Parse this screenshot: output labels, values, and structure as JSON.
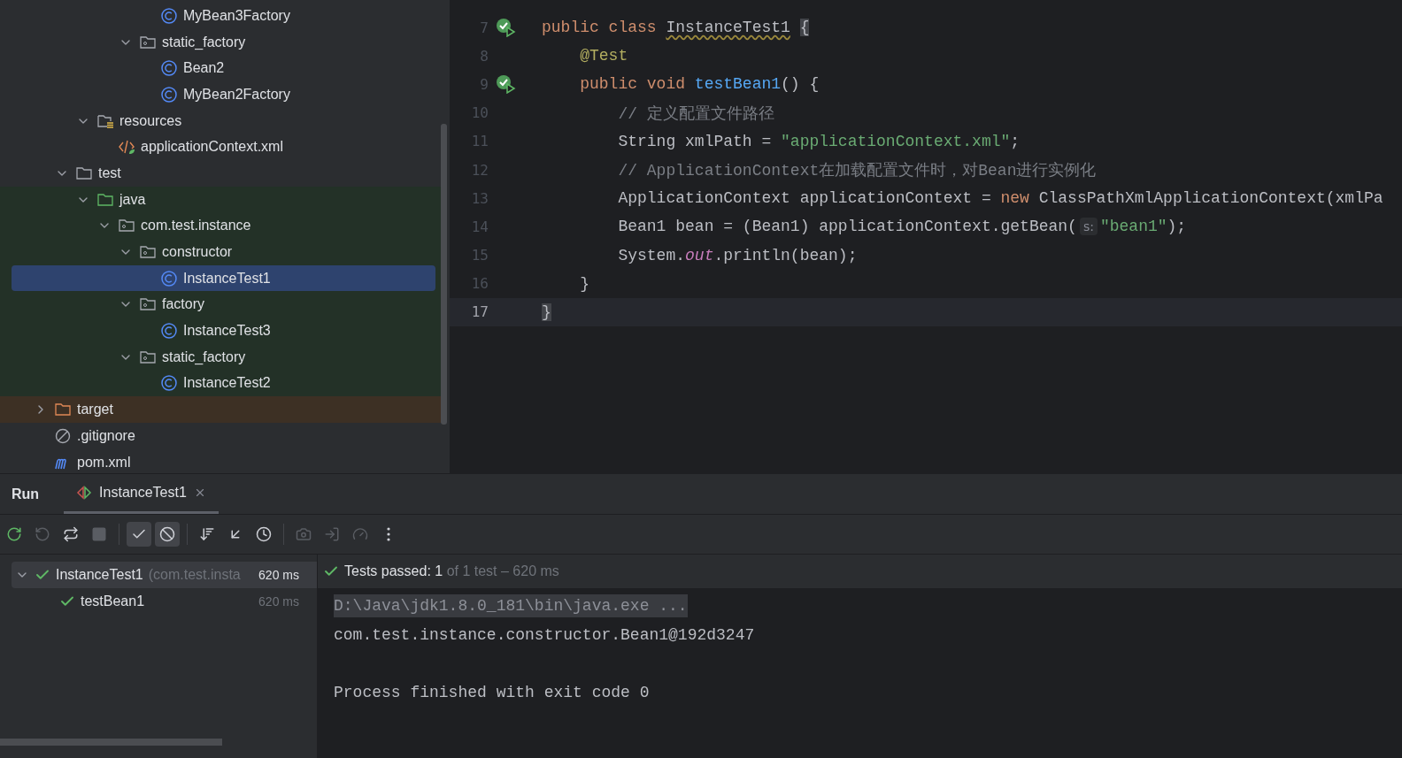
{
  "project_tree": {
    "items": [
      {
        "children": [
          {
            "children": [
              {
                "children": [
                  {
                    "children": [
                      {
                        "children": [
                          {
                            "label": "MyBean3Factory",
                            "kind": "class",
                            "selected": false
                          }
                        ]
                      },
                      {
                        "label": "static_factory",
                        "kind": "package",
                        "expanded": true,
                        "selected": false,
                        "children": [
                          {
                            "label": "Bean2",
                            "kind": "class",
                            "selected": false
                          },
                          {
                            "label": "MyBean2Factory",
                            "kind": "class",
                            "selected": false
                          }
                        ]
                      }
                    ]
                  }
                ]
              },
              {
                "label": "resources",
                "kind": "resources-root",
                "expanded": true,
                "selected": false,
                "children": [
                  {
                    "label": "applicationContext.xml",
                    "kind": "xml",
                    "selected": false
                  }
                ]
              }
            ]
          },
          {
            "label": "test",
            "kind": "folder",
            "expanded": true,
            "selected": false,
            "children": [
              {
                "label": "java",
                "kind": "test-root",
                "expanded": true,
                "selected": false,
                "children": [
                  {
                    "label": "com.test.instance",
                    "kind": "package",
                    "expanded": true,
                    "selected": false,
                    "children": [
                      {
                        "label": "constructor",
                        "kind": "package",
                        "expanded": true,
                        "selected": false,
                        "children": [
                          {
                            "label": "InstanceTest1",
                            "kind": "class",
                            "selected": true
                          }
                        ]
                      },
                      {
                        "label": "factory",
                        "kind": "package",
                        "expanded": true,
                        "selected": false,
                        "children": [
                          {
                            "label": "InstanceTest3",
                            "kind": "class",
                            "selected": false
                          }
                        ]
                      },
                      {
                        "label": "static_factory",
                        "kind": "package",
                        "expanded": true,
                        "selected": false,
                        "children": [
                          {
                            "label": "InstanceTest2",
                            "kind": "class",
                            "selected": false
                          }
                        ]
                      }
                    ]
                  }
                ]
              }
            ]
          }
        ]
      },
      {
        "label": "target",
        "kind": "excluded",
        "expanded": false,
        "selected": false
      },
      {
        "label": ".gitignore",
        "kind": "ignore",
        "selected": false
      },
      {
        "label": "pom.xml",
        "kind": "maven",
        "selected": false
      }
    ]
  },
  "editor": {
    "lines": [
      {
        "number": "7",
        "run_marker": true,
        "current": false,
        "tokens": [
          {
            "kind": "keyword",
            "text": "public class "
          },
          {
            "kind": "warn-name",
            "text": "InstanceTest1"
          },
          {
            "kind": "brace-match",
            "text": "{",
            "gap_before": true
          }
        ]
      },
      {
        "number": "8",
        "run_marker": false,
        "current": false,
        "tokens": [
          {
            "kind": "annotation",
            "text": "    @Test"
          }
        ]
      },
      {
        "number": "9",
        "run_marker": true,
        "current": false,
        "tokens": [
          {
            "kind": "keyword",
            "text": "    public void "
          },
          {
            "kind": "method",
            "text": "testBean1"
          },
          {
            "kind": "plain",
            "text": "() {"
          }
        ]
      },
      {
        "number": "10",
        "run_marker": false,
        "current": false,
        "tokens": [
          {
            "kind": "comment",
            "text": "        // 定义配置文件路径"
          }
        ]
      },
      {
        "number": "11",
        "run_marker": false,
        "current": false,
        "tokens": [
          {
            "kind": "plain",
            "text": "        String xmlPath = "
          },
          {
            "kind": "string",
            "text": "\"applicationContext.xml\""
          },
          {
            "kind": "plain",
            "text": ";"
          }
        ]
      },
      {
        "number": "12",
        "run_marker": false,
        "current": false,
        "tokens": [
          {
            "kind": "comment",
            "text": "        // ApplicationContext在加载配置文件时，对Bean进行实例化"
          }
        ]
      },
      {
        "number": "13",
        "run_marker": false,
        "current": false,
        "tokens": [
          {
            "kind": "plain",
            "text": "        ApplicationContext applicationContext = "
          },
          {
            "kind": "keyword",
            "text": "new"
          },
          {
            "kind": "plain",
            "text": " ClassPathXmlApplicationContext(xmlPa"
          }
        ]
      },
      {
        "number": "14",
        "run_marker": false,
        "current": false,
        "tokens": [
          {
            "kind": "plain",
            "text": "        Bean1 bean = (Bean1) applicationContext.getBean("
          },
          {
            "kind": "hint",
            "text": "s:"
          },
          {
            "kind": "string",
            "text": "\"bean1\""
          },
          {
            "kind": "plain",
            "text": ");"
          }
        ]
      },
      {
        "number": "15",
        "run_marker": false,
        "current": false,
        "tokens": [
          {
            "kind": "plain",
            "text": "        System."
          },
          {
            "kind": "static",
            "text": "out"
          },
          {
            "kind": "plain",
            "text": ".println(bean);"
          }
        ]
      },
      {
        "number": "16",
        "run_marker": false,
        "current": false,
        "tokens": [
          {
            "kind": "plain",
            "text": "    }"
          }
        ]
      },
      {
        "number": "17",
        "run_marker": false,
        "current": true,
        "tokens": [
          {
            "kind": "brace-match",
            "text": "}"
          }
        ]
      }
    ]
  },
  "run_panel": {
    "title": "Run",
    "tabs": [
      {
        "label": "InstanceTest1",
        "selected": true
      }
    ],
    "toolbar": [
      {
        "kind": "rerun",
        "disabled": false,
        "on": false
      },
      {
        "kind": "rerun-failed",
        "disabled": true,
        "on": false
      },
      {
        "kind": "auto-test",
        "disabled": false,
        "on": false
      },
      {
        "kind": "stop",
        "disabled": true,
        "on": false
      },
      {
        "kind": "sep"
      },
      {
        "kind": "show-passed",
        "disabled": false,
        "on": true
      },
      {
        "kind": "show-ignored",
        "disabled": false,
        "on": true
      },
      {
        "kind": "sep"
      },
      {
        "kind": "sort",
        "disabled": false,
        "on": false
      },
      {
        "kind": "collapse",
        "disabled": false,
        "on": false
      },
      {
        "kind": "history",
        "disabled": false,
        "on": false
      },
      {
        "kind": "sep"
      },
      {
        "kind": "camera",
        "disabled": true,
        "on": false
      },
      {
        "kind": "export",
        "disabled": true,
        "on": false
      },
      {
        "kind": "gauge",
        "disabled": true,
        "on": false
      },
      {
        "kind": "more",
        "disabled": false,
        "on": false
      }
    ],
    "tests": [
      {
        "name": "InstanceTest1",
        "package": "(com.test.insta",
        "duration": "620 ms",
        "selected": true,
        "expanded": true,
        "children": [
          {
            "name": "testBean1",
            "duration": "620 ms",
            "selected": false
          }
        ]
      }
    ],
    "status": {
      "passed": "Tests passed: 1",
      "detail": "of 1 test – 620 ms"
    },
    "console": [
      {
        "text": "D:\\Java\\jdk1.8.0_181\\bin\\java.exe ...",
        "kind": "command"
      },
      {
        "text": "com.test.instance.constructor.Bean1@192d3247",
        "kind": "output"
      },
      {
        "kind": "blank"
      },
      {
        "text": "Process finished with exit code 0",
        "kind": "output"
      }
    ]
  }
}
